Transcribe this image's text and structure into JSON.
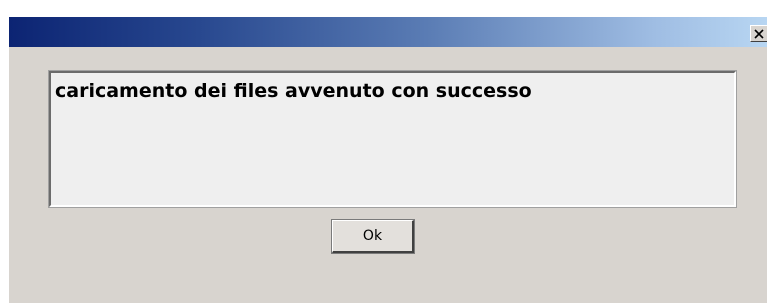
{
  "dialog": {
    "title": "",
    "close_icon": "close-icon",
    "message": "caricamento dei files avvenuto con successo",
    "ok_label": "Ok"
  },
  "colors": {
    "titlebar_start": "#0c2473",
    "titlebar_end": "#b8d6f2",
    "dialog_bg": "#d8d4cf",
    "message_bg": "#efefef"
  }
}
